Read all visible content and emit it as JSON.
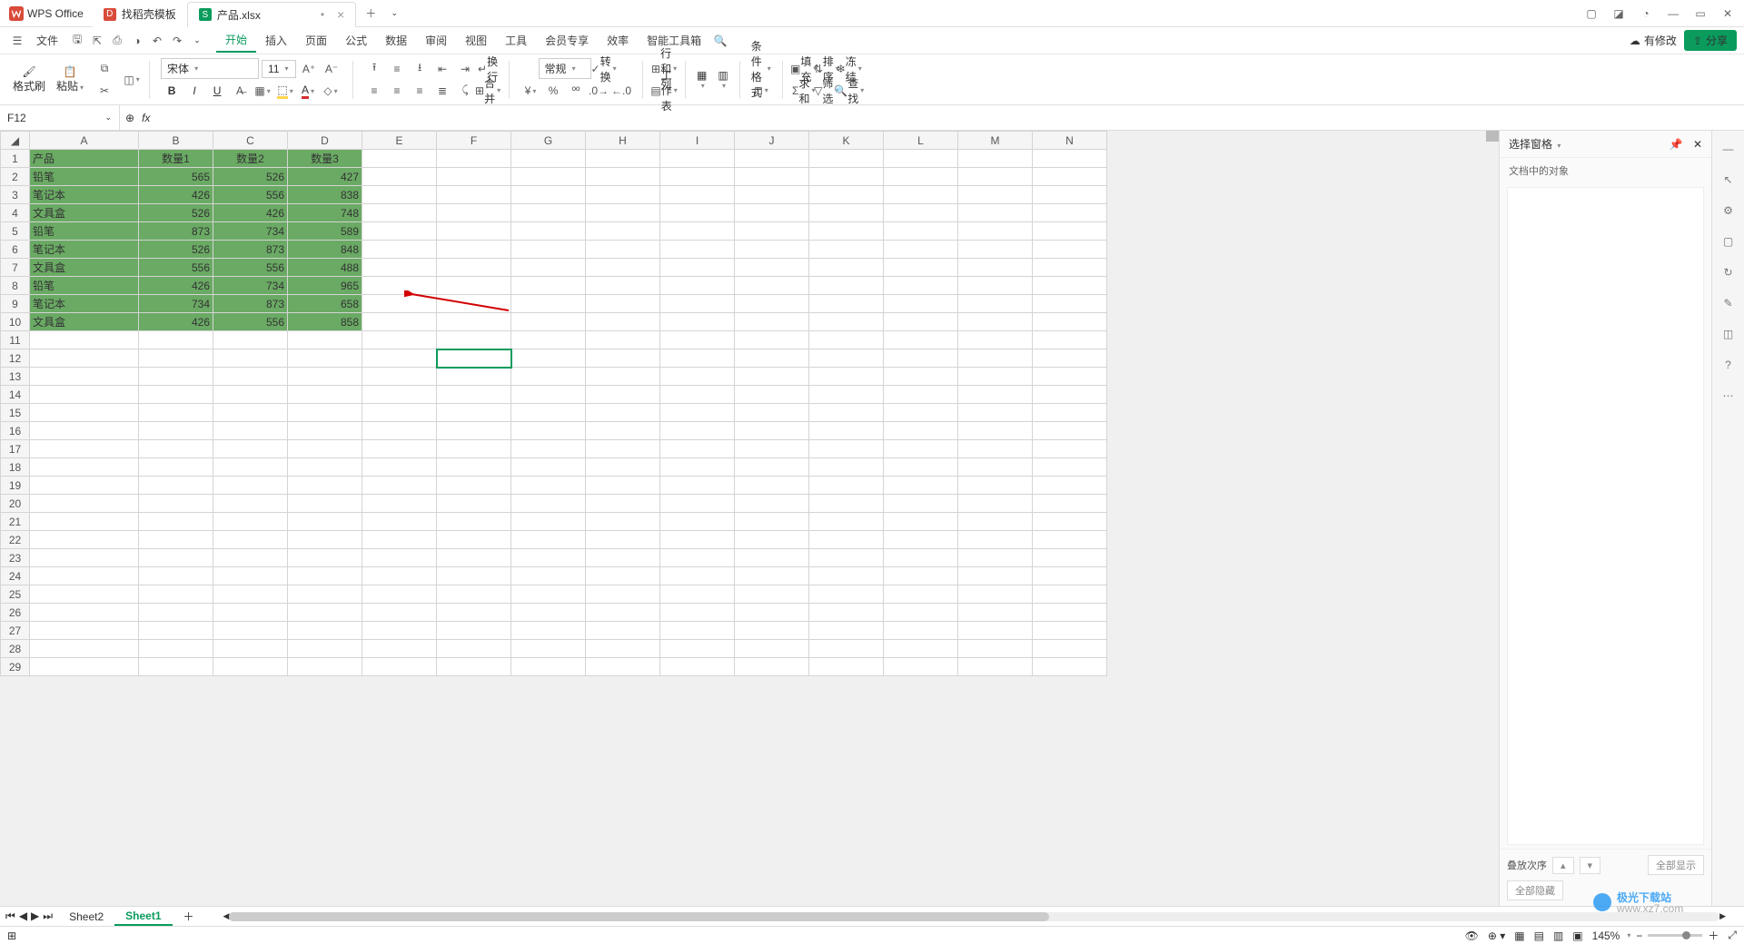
{
  "app_name": "WPS Office",
  "tabs": [
    {
      "label": "找稻壳模板",
      "icon_bg": "#d94b3a"
    },
    {
      "label": "产品.xlsx",
      "icon_bg": "#0a9b5d",
      "active": true,
      "dirty": "•"
    }
  ],
  "menu": {
    "file": "文件",
    "items": [
      "开始",
      "插入",
      "页面",
      "公式",
      "数据",
      "审阅",
      "视图",
      "工具",
      "会员专享",
      "效率",
      "智能工具箱"
    ],
    "active": "开始",
    "modify": "有修改",
    "share": "分享"
  },
  "ribbon": {
    "format_brush": "格式刷",
    "paste": "粘贴",
    "font_name": "宋体",
    "font_size": "11",
    "wrap": "换行",
    "merge": "合并",
    "number_format": "常规",
    "convert": "转换",
    "row_col": "行和列",
    "worksheet": "工作表",
    "cond_format": "条件格式",
    "fill": "填充",
    "sort": "排序",
    "freeze": "冻结",
    "sum": "求和",
    "filter": "筛选",
    "find": "查找"
  },
  "name_box": "F12",
  "columns": [
    "A",
    "B",
    "C",
    "D",
    "E",
    "F",
    "G",
    "H",
    "I",
    "J",
    "K",
    "L",
    "M",
    "N"
  ],
  "chart_data": {
    "type": "table",
    "headers": [
      "产品",
      "数量1",
      "数量2",
      "数量3"
    ],
    "rows": [
      [
        "铅笔",
        565,
        526,
        427
      ],
      [
        "笔记本",
        426,
        556,
        838
      ],
      [
        "文具盒",
        526,
        426,
        748
      ],
      [
        "铅笔",
        873,
        734,
        589
      ],
      [
        "笔记本",
        526,
        873,
        848
      ],
      [
        "文具盒",
        556,
        556,
        488
      ],
      [
        "铅笔",
        426,
        734,
        965
      ],
      [
        "笔记本",
        734,
        873,
        658
      ],
      [
        "文具盒",
        426,
        556,
        858
      ]
    ]
  },
  "selected_cell": "F12",
  "side_panel": {
    "title": "选择窗格",
    "subtitle": "文档中的对象",
    "stack_order": "叠放次序",
    "show_all": "全部显示",
    "hide_all": "全部隐藏"
  },
  "sheet_tabs": [
    "Sheet2",
    "Sheet1"
  ],
  "active_sheet": "Sheet1",
  "status": {
    "zoom": "145%"
  },
  "watermark": "极光下载站"
}
